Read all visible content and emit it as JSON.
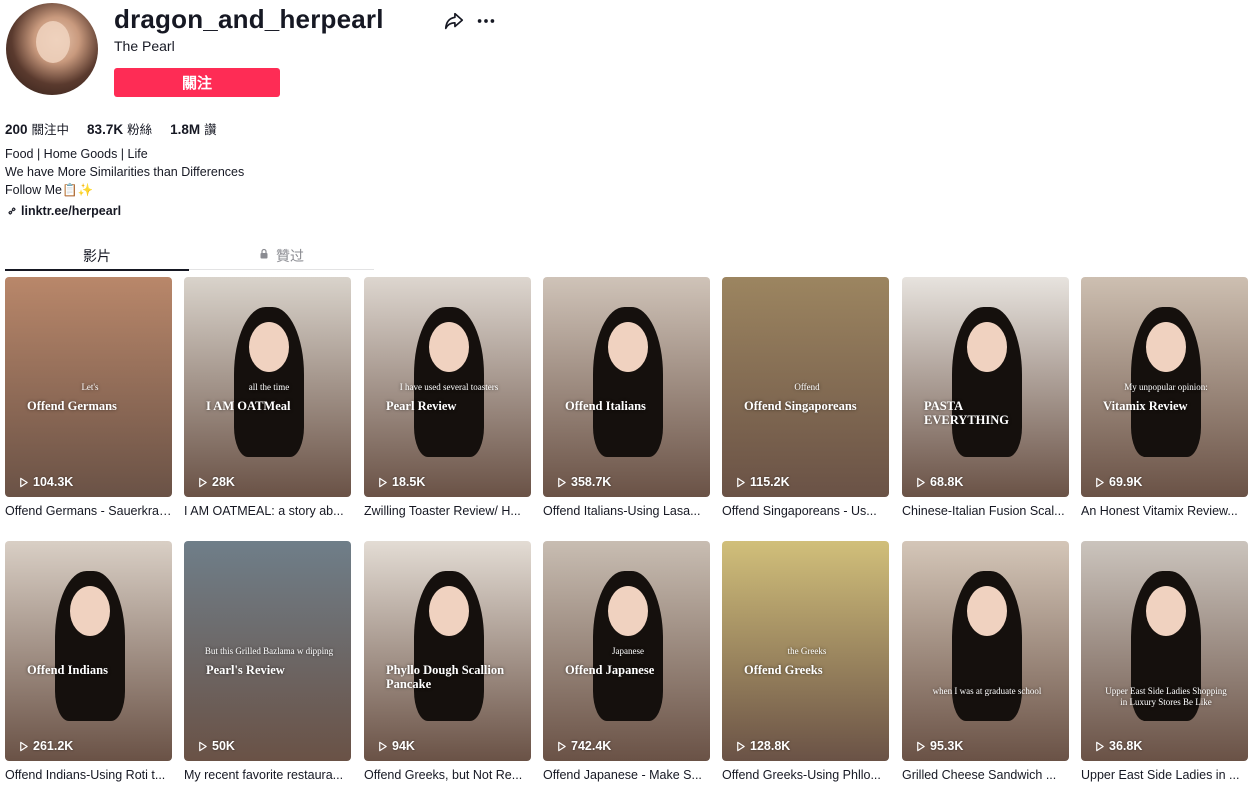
{
  "profile": {
    "username": "dragon_and_herpearl",
    "nickname": "The Pearl",
    "follow_label": "關注",
    "stats": [
      {
        "value": "200",
        "label": "關注中"
      },
      {
        "value": "83.7K",
        "label": "粉絲"
      },
      {
        "value": "1.8M",
        "label": "讚"
      }
    ],
    "bio": [
      "Food | Home Goods | Life",
      "We have More Similarities than Differences",
      "Follow Me📋✨"
    ],
    "link": "linktr.ee/herpearl"
  },
  "tabs": [
    {
      "label": "影片",
      "active": true
    },
    {
      "label": "贊过",
      "active": false,
      "icon": "lock-icon"
    }
  ],
  "colors": {
    "accent": "#fe2c55",
    "text": "#161823",
    "muted": "#8a8b91"
  },
  "videos": [
    {
      "views": "104.3K",
      "caption": "Offend Germans - Sauerkraut...",
      "overlay": "Offend Germans",
      "overlay2": "Let's",
      "bg": "#b9876a"
    },
    {
      "views": "28K",
      "caption": "I AM OATMEAL: a story ab...",
      "overlay": "I AM OATMeal",
      "overlay2": "all the time",
      "bg": "#d9d3cb"
    },
    {
      "views": "18.5K",
      "caption": "Zwilling Toaster Review/ H...",
      "overlay": "Pearl Review",
      "overlay2": "I have used several toasters",
      "bg": "#ddd6cf"
    },
    {
      "views": "358.7K",
      "caption": "Offend Italians-Using Lasa...",
      "overlay": "Offend Italians",
      "overlay2": "",
      "bg": "#cfc3b8"
    },
    {
      "views": "115.2K",
      "caption": "Offend Singaporeans - Us...",
      "overlay": "Offend Singaporeans",
      "overlay2": "Offend",
      "bg": "#9c8560"
    },
    {
      "views": "68.8K",
      "caption": "Chinese-Italian Fusion Scal...",
      "overlay": "PASTA EVERYTHING",
      "overlay2": "",
      "bg": "#e7e3de"
    },
    {
      "views": "69.9K",
      "caption": "An Honest Vitamix Review...",
      "overlay": "Vitamix Review",
      "overlay2": "My unpopular opinion:",
      "bg": "#cdbfb1"
    },
    {
      "views": "261.2K",
      "caption": "Offend Indians-Using Roti t...",
      "overlay": "Offend Indians",
      "overlay2": "",
      "bg": "#d9cfc5"
    },
    {
      "views": "50K",
      "caption": "My recent favorite restaura...",
      "overlay": "Pearl's Review",
      "overlay2": "But this Grilled Bazlama w dipping",
      "bg": "#6f7e89"
    },
    {
      "views": "94K",
      "caption": "Offend Greeks, but Not Re...",
      "overlay": "Phyllo Dough Scallion Pancake",
      "overlay2": "",
      "bg": "#e3dcd4"
    },
    {
      "views": "742.4K",
      "caption": "Offend Japanese - Make S...",
      "overlay": "Offend Japanese",
      "overlay2": "Japanese",
      "bg": "#c8bdb2"
    },
    {
      "views": "128.8K",
      "caption": "Offend Greeks-Using Phllo...",
      "overlay": "Offend Greeks",
      "overlay2": "the Greeks",
      "bg": "#d1bf7a"
    },
    {
      "views": "95.3K",
      "caption": "Grilled Cheese Sandwich ...",
      "overlay": "",
      "overlay2": "when I was at graduate school",
      "bg": "#d4c6b8"
    },
    {
      "views": "36.8K",
      "caption": "Upper East Side Ladies in ...",
      "overlay": "",
      "overlay2": "Upper East Side Ladies Shopping in Luxury Stores Be Like",
      "bg": "#cbc4bd"
    }
  ]
}
